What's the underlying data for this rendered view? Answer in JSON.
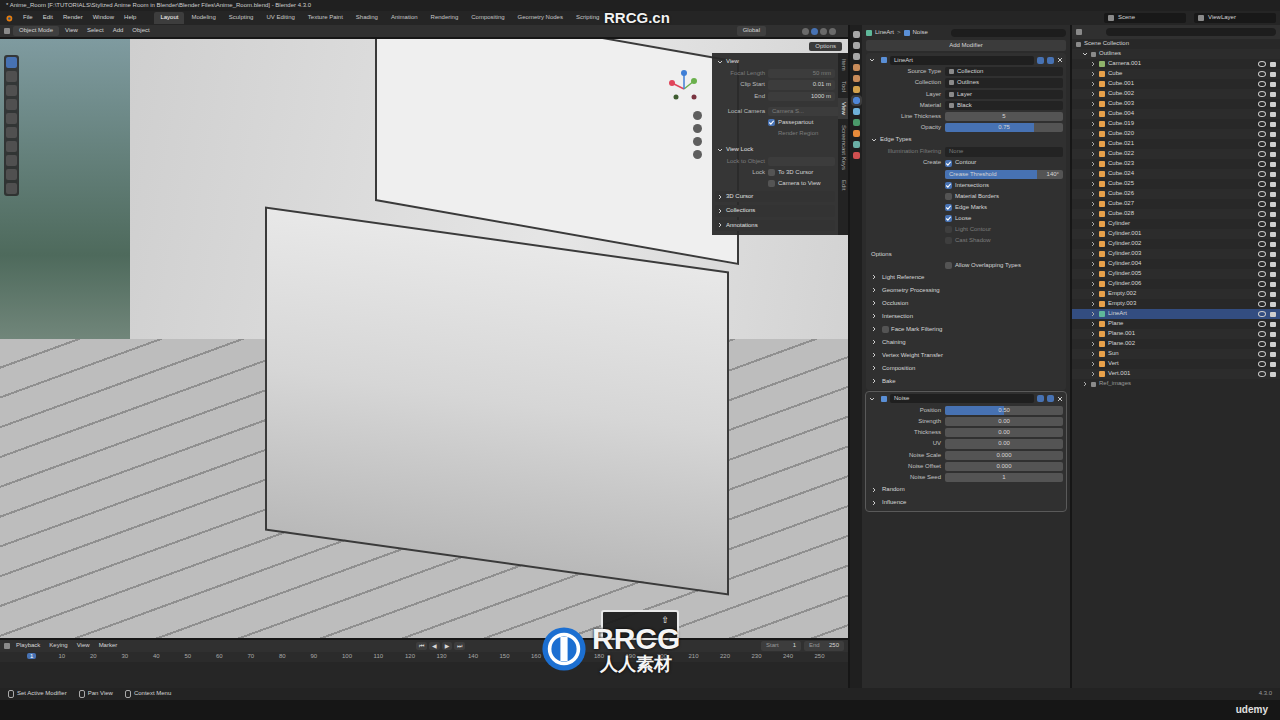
{
  "window": {
    "title": "* Anime_Room [F:\\TUTORIALS\\Stylized Anime Room in Blender\\Blender Files\\Anime_Room.blend] - Blender 4.3.0"
  },
  "menu": [
    "File",
    "Edit",
    "Render",
    "Window",
    "Help"
  ],
  "workspaces": [
    {
      "label": "Layout",
      "selected": true
    },
    {
      "label": "Modeling",
      "selected": false
    },
    {
      "label": "Sculpting",
      "selected": false
    },
    {
      "label": "UV Editing",
      "selected": false
    },
    {
      "label": "Texture Paint",
      "selected": false
    },
    {
      "label": "Shading",
      "selected": false
    },
    {
      "label": "Animation",
      "selected": false
    },
    {
      "label": "Rendering",
      "selected": false
    },
    {
      "label": "Compositing",
      "selected": false
    },
    {
      "label": "Geometry Nodes",
      "selected": false
    },
    {
      "label": "Scripting",
      "selected": false
    }
  ],
  "scene": "Scene",
  "view_layer": "ViewLayer",
  "viewport_header": {
    "mode": "Object Mode",
    "menus": [
      "View",
      "Select",
      "Add",
      "Object"
    ],
    "orientation": "Global",
    "options": "Options"
  },
  "n_panel": {
    "tabs": [
      {
        "label": "Item",
        "selected": false
      },
      {
        "label": "Tool",
        "selected": false
      },
      {
        "label": "View",
        "selected": true
      },
      {
        "label": "Screencast Keys",
        "selected": false
      },
      {
        "label": "Edit",
        "selected": false
      }
    ],
    "section": "View",
    "fields": [
      {
        "label": "Focal Length",
        "value": "50 mm",
        "disabled": true
      },
      {
        "label": "Clip Start",
        "value": "0.01 m",
        "disabled": false
      },
      {
        "label": "End",
        "value": "1000 m",
        "disabled": false
      }
    ],
    "local_camera": {
      "label": "Local Camera",
      "value": "Camera S..."
    },
    "passepartout": {
      "label": "Passepartout",
      "checked": true
    },
    "render_region": "Render Region",
    "view_lock": {
      "title": "View Lock",
      "lock_to_object": "Lock to Object",
      "lock": "Lock",
      "options": [
        {
          "label": "To 3D Cursor",
          "checked": false
        },
        {
          "label": "Camera to View",
          "checked": false
        }
      ]
    },
    "collapsed": [
      "3D Cursor",
      "Collections",
      "Annotations"
    ]
  },
  "properties": {
    "breadcrumb": [
      "LineArt",
      ">",
      "Noise"
    ],
    "add_modifier": "Add Modifier",
    "lineart": {
      "name": "LineArt",
      "rows": [
        {
          "kind": "select",
          "label": "Source Type",
          "value": "Collection"
        },
        {
          "kind": "select",
          "label": "Collection",
          "value": "Outlines"
        },
        {
          "kind": "select",
          "label": "Layer",
          "value": "Layer"
        },
        {
          "kind": "select",
          "label": "Material",
          "value": "Black"
        },
        {
          "kind": "number",
          "label": "Line Thickness",
          "value": "5"
        },
        {
          "kind": "slider",
          "label": "Opacity",
          "value": "0.75",
          "level": 0.75
        }
      ],
      "edge_types": {
        "title": "Edge Types",
        "illumination": {
          "label": "Illumination Filtering",
          "value": "None"
        },
        "create": {
          "label": "Create",
          "text": "Contour",
          "checked": true
        },
        "crease": {
          "text": "Crease Threshold",
          "reading": "140°",
          "level": 0.78
        },
        "checks": [
          {
            "label": "Intersections",
            "checked": true,
            "disabled": false
          },
          {
            "label": "Material Borders",
            "checked": false,
            "disabled": false
          },
          {
            "label": "Edge Marks",
            "checked": true,
            "disabled": false
          },
          {
            "label": "Loose",
            "checked": true,
            "disabled": false
          },
          {
            "label": "Light Contour",
            "checked": false,
            "disabled": true
          },
          {
            "label": "Cast Shadow",
            "checked": false,
            "disabled": true
          }
        ]
      },
      "options": {
        "title": "Options",
        "label": "Allow Overlapping Types",
        "checked": false
      },
      "subpanels": [
        {
          "label": "Light Reference",
          "kind": "plain",
          "checked": false
        },
        {
          "label": "Geometry Processing",
          "kind": "plain",
          "checked": false
        },
        {
          "label": "Occlusion",
          "kind": "plain",
          "checked": false
        },
        {
          "label": "Intersection",
          "kind": "plain",
          "checked": false
        },
        {
          "label": "Face Mark Filtering",
          "kind": "toggle",
          "checked": false
        },
        {
          "label": "Chaining",
          "kind": "plain",
          "checked": false
        },
        {
          "label": "Vertex Weight Transfer",
          "kind": "plain",
          "checked": false
        },
        {
          "label": "Composition",
          "kind": "plain",
          "checked": false
        },
        {
          "label": "Bake",
          "kind": "plain",
          "checked": false
        }
      ]
    },
    "noise": {
      "name": "Noise",
      "rows": [
        {
          "kind": "slider",
          "label": "Position",
          "value": "0.50",
          "level": 0.5
        },
        {
          "kind": "number",
          "label": "Strength",
          "value": "0.00"
        },
        {
          "kind": "number",
          "label": "Thickness",
          "value": "0.00"
        },
        {
          "kind": "number",
          "label": "UV",
          "value": "0.00"
        },
        {
          "kind": "number",
          "label": "Noise Scale",
          "value": "0.000"
        },
        {
          "kind": "number",
          "label": "Noise Offset",
          "value": "0.000"
        },
        {
          "kind": "number",
          "label": "Noise Seed",
          "value": "1"
        }
      ],
      "subpanels": [
        "Random",
        "Influence"
      ]
    }
  },
  "outliner": {
    "root": "Scene Collection",
    "collection": "Outlines",
    "items": [
      {
        "name": "Camera.001",
        "kind": "camera",
        "selected": false
      },
      {
        "name": "Cube",
        "kind": "mesh",
        "selected": false
      },
      {
        "name": "Cube.001",
        "kind": "mesh",
        "selected": false
      },
      {
        "name": "Cube.002",
        "kind": "mesh",
        "selected": false
      },
      {
        "name": "Cube.003",
        "kind": "mesh",
        "selected": false
      },
      {
        "name": "Cube.004",
        "kind": "mesh",
        "selected": false
      },
      {
        "name": "Cube.019",
        "kind": "mesh",
        "selected": false
      },
      {
        "name": "Cube.020",
        "kind": "mesh",
        "selected": false
      },
      {
        "name": "Cube.021",
        "kind": "mesh",
        "selected": false
      },
      {
        "name": "Cube.022",
        "kind": "mesh",
        "selected": false
      },
      {
        "name": "Cube.023",
        "kind": "mesh",
        "selected": false
      },
      {
        "name": "Cube.024",
        "kind": "mesh",
        "selected": false
      },
      {
        "name": "Cube.025",
        "kind": "mesh",
        "selected": false
      },
      {
        "name": "Cube.026",
        "kind": "mesh",
        "selected": false
      },
      {
        "name": "Cube.027",
        "kind": "mesh",
        "selected": false
      },
      {
        "name": "Cube.028",
        "kind": "mesh",
        "selected": false
      },
      {
        "name": "Cylinder",
        "kind": "mesh",
        "selected": false
      },
      {
        "name": "Cylinder.001",
        "kind": "mesh",
        "selected": false
      },
      {
        "name": "Cylinder.002",
        "kind": "mesh",
        "selected": false
      },
      {
        "name": "Cylinder.003",
        "kind": "mesh",
        "selected": false
      },
      {
        "name": "Cylinder.004",
        "kind": "mesh",
        "selected": false
      },
      {
        "name": "Cylinder.005",
        "kind": "mesh",
        "selected": false
      },
      {
        "name": "Cylinder.006",
        "kind": "mesh",
        "selected": false
      },
      {
        "name": "Empty.002",
        "kind": "empty",
        "selected": false
      },
      {
        "name": "Empty.003",
        "kind": "empty",
        "selected": false
      },
      {
        "name": "LineArt",
        "kind": "lineart",
        "selected": true
      },
      {
        "name": "Plane",
        "kind": "mesh",
        "selected": false
      },
      {
        "name": "Plane.001",
        "kind": "mesh",
        "selected": false
      },
      {
        "name": "Plane.002",
        "kind": "mesh",
        "selected": false
      },
      {
        "name": "Sun",
        "kind": "light",
        "selected": false
      },
      {
        "name": "Vert",
        "kind": "mesh",
        "selected": false
      },
      {
        "name": "Vert.001",
        "kind": "mesh",
        "selected": false
      }
    ],
    "other_collection": "Ref_images"
  },
  "timeline": {
    "menus": [
      "Playback",
      "Keying",
      "View",
      "Marker"
    ],
    "transport": [
      "⏮",
      "◀",
      "▶",
      "⏭"
    ],
    "start_label": "Start",
    "start": "1",
    "end_label": "End",
    "end": "250",
    "current": "1",
    "ticks": [
      "0",
      "10",
      "20",
      "30",
      "40",
      "50",
      "60",
      "70",
      "80",
      "90",
      "100",
      "110",
      "120",
      "130",
      "140",
      "150",
      "160",
      "170",
      "180",
      "190",
      "200",
      "210",
      "220",
      "230",
      "240",
      "250"
    ]
  },
  "status_bar": {
    "hints": [
      "Set Active Modifier",
      "Pan View",
      "Context Menu"
    ],
    "version": "4.3.0"
  },
  "overlay": {
    "key": "⇧",
    "site": "RRCG.cn",
    "logo": "RRCG",
    "logo_cn": "人人素材",
    "brand": "udemy"
  }
}
